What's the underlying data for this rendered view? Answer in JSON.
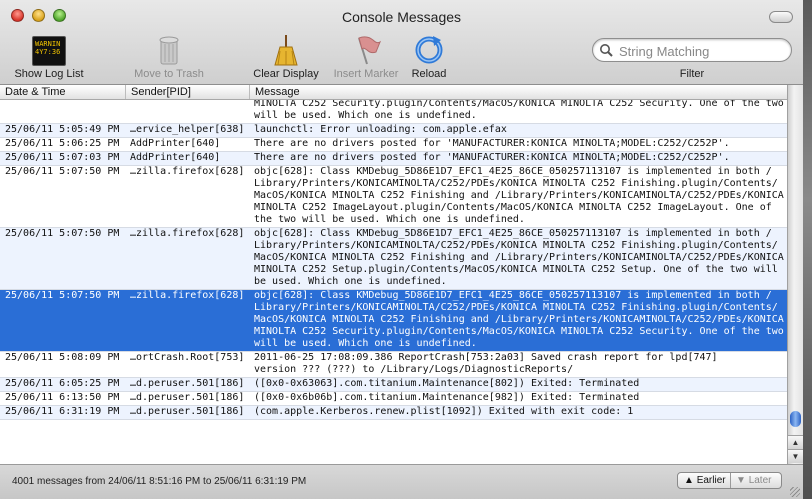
{
  "window": {
    "title": "Console Messages"
  },
  "toolbar": {
    "show_log_list": "Show Log List",
    "warning_icon_text": "WARNIN\n4Y7:36",
    "move_to_trash": "Move to Trash",
    "clear_display": "Clear Display",
    "insert_marker": "Insert Marker",
    "reload": "Reload",
    "filter": "Filter",
    "search_placeholder": "String Matching"
  },
  "table": {
    "headers": {
      "date": "Date & Time",
      "sender": "Sender[PID]",
      "message": "Message"
    },
    "rows": [
      {
        "date": "",
        "sender": "",
        "lines": [
          "MINOLTA C252 Security.plugin/Contents/MacOS/KONICA MINOLTA C252 Security. One of the two",
          "will be used. Which one is undefined."
        ]
      },
      {
        "date": "25/06/11 5:05:49 PM",
        "sender": "…ervice_helper[638]",
        "lines": [
          "launchctl: Error unloading: com.apple.efax"
        ]
      },
      {
        "date": "25/06/11 5:06:25 PM",
        "sender": "AddPrinter[640]",
        "lines": [
          "There are no drivers posted for 'MANUFACTURER:KONICA MINOLTA;MODEL:C252/C252P'."
        ]
      },
      {
        "date": "25/06/11 5:07:03 PM",
        "sender": "AddPrinter[640]",
        "lines": [
          "There are no drivers posted for 'MANUFACTURER:KONICA MINOLTA;MODEL:C252/C252P'."
        ]
      },
      {
        "date": "25/06/11 5:07:50 PM",
        "sender": "…zilla.firefox[628]",
        "lines": [
          "objc[628]: Class KMDebug_5D86E1D7_EFC1_4E25_86CE_050257113107 is implemented in both /",
          "Library/Printers/KONICAMINOLTA/C252/PDEs/KONICA MINOLTA C252 Finishing.plugin/Contents/",
          "MacOS/KONICA MINOLTA C252 Finishing and /Library/Printers/KONICAMINOLTA/C252/PDEs/KONICA",
          "MINOLTA C252 ImageLayout.plugin/Contents/MacOS/KONICA MINOLTA C252 ImageLayout. One of",
          "the two will be used. Which one is undefined."
        ]
      },
      {
        "date": "25/06/11 5:07:50 PM",
        "sender": "…zilla.firefox[628]",
        "lines": [
          "objc[628]: Class KMDebug_5D86E1D7_EFC1_4E25_86CE_050257113107 is implemented in both /",
          "Library/Printers/KONICAMINOLTA/C252/PDEs/KONICA MINOLTA C252 Finishing.plugin/Contents/",
          "MacOS/KONICA MINOLTA C252 Finishing and /Library/Printers/KONICAMINOLTA/C252/PDEs/KONICA",
          "MINOLTA C252 Setup.plugin/Contents/MacOS/KONICA MINOLTA C252 Setup. One of the two will",
          "be used. Which one is undefined."
        ]
      },
      {
        "date": "25/06/11 5:07:50 PM",
        "sender": "…zilla.firefox[628]",
        "lines": [
          "objc[628]: Class KMDebug_5D86E1D7_EFC1_4E25_86CE_050257113107 is implemented in both /",
          "Library/Printers/KONICAMINOLTA/C252/PDEs/KONICA MINOLTA C252 Finishing.plugin/Contents/",
          "MacOS/KONICA MINOLTA C252 Finishing and /Library/Printers/KONICAMINOLTA/C252/PDEs/KONICA",
          "MINOLTA C252 Security.plugin/Contents/MacOS/KONICA MINOLTA C252 Security. One of the two",
          "will be used. Which one is undefined."
        ]
      },
      {
        "date": "25/06/11 5:08:09 PM",
        "sender": "…ortCrash.Root[753]",
        "lines": [
          "2011-06-25 17:08:09.386 ReportCrash[753:2a03] Saved crash report for lpd[747]",
          "version ??? (???) to /Library/Logs/DiagnosticReports/"
        ]
      },
      {
        "date": "25/06/11 6:05:25 PM",
        "sender": "…d.peruser.501[186]",
        "lines": [
          "([0x0-0x63063].com.titanium.Maintenance[802]) Exited: Terminated"
        ]
      },
      {
        "date": "25/06/11 6:13:50 PM",
        "sender": "…d.peruser.501[186]",
        "lines": [
          "([0x0-0x6b06b].com.titanium.Maintenance[982]) Exited: Terminated"
        ]
      },
      {
        "date": "25/06/11 6:31:19 PM",
        "sender": "…d.peruser.501[186]",
        "lines": [
          "(com.apple.Kerberos.renew.plist[1092]) Exited with exit code: 1"
        ]
      }
    ]
  },
  "status": {
    "count": "4001 messages from 24/06/11 8:51:16 PM to 25/06/11 6:31:19 PM",
    "earlier": "Earlier",
    "later": "Later"
  }
}
